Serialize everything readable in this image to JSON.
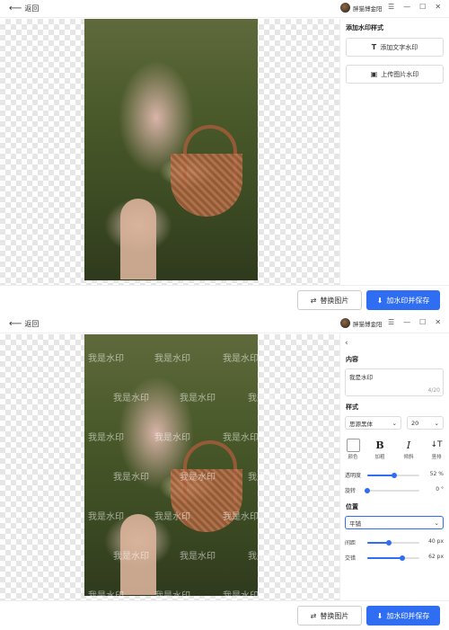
{
  "header": {
    "back_label": "返回",
    "user_name": "胖猫博金阳",
    "menu_icon": "hamburger-icon",
    "minimize_icon": "minimize-icon",
    "maximize_icon": "maximize-icon",
    "close_icon": "close-icon"
  },
  "panel1": {
    "title": "添加水印样式",
    "text_watermark_label": "添加文字水印",
    "image_watermark_label": "上传图片水印"
  },
  "footer": {
    "replace_label": "替换图片",
    "save_label": "加水印并保存"
  },
  "panel2": {
    "content_heading": "内容",
    "content_value": "我是水印",
    "char_count": "4/20",
    "style_heading": "样式",
    "font_value": "思源黑体",
    "size_value": "20",
    "color_label": "颜色",
    "bold_symbol": "B",
    "bold_label": "加粗",
    "italic_symbol": "I",
    "italic_label": "倾斜",
    "vertical_symbol": "↓T",
    "vertical_label": "竖排",
    "opacity_label": "透明度",
    "opacity_value": "52",
    "opacity_unit": "%",
    "opacity_fraction": 0.52,
    "rotation_label": "旋转",
    "rotation_value": "0",
    "rotation_unit": "°",
    "rotation_fraction": 0.0,
    "position_heading": "位置",
    "position_value": "平铺",
    "spacing_label": "间距",
    "spacing_value": "40",
    "spacing_unit": "px",
    "spacing_fraction": 0.42,
    "line_spacing_label": "交错",
    "line_spacing_value": "62",
    "line_spacing_unit": "px",
    "line_spacing_fraction": 0.68
  },
  "watermark_text": "我是水印"
}
